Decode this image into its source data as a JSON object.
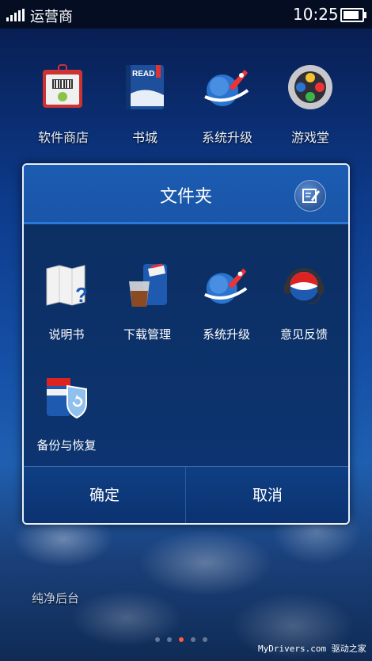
{
  "status_bar": {
    "carrier": "运营商",
    "time": "10:25",
    "battery_level": 0.85
  },
  "desktop_apps": [
    {
      "label": "软件商店",
      "icon": "store-bag-icon"
    },
    {
      "label": "书城",
      "icon": "read-book-icon"
    },
    {
      "label": "系统升级",
      "icon": "rocket-globe-icon"
    },
    {
      "label": "游戏堂",
      "icon": "gamepad-icon"
    }
  ],
  "dialog": {
    "title": "文件夹",
    "edit_icon": "edit-icon",
    "items": [
      {
        "label": "说明书",
        "icon": "manual-map-icon"
      },
      {
        "label": "下载管理",
        "icon": "download-cup-icon"
      },
      {
        "label": "系统升级",
        "icon": "rocket-globe-icon"
      },
      {
        "label": "意见反馈",
        "icon": "headset-feedback-icon"
      },
      {
        "label": "备份与恢复",
        "icon": "backup-restore-icon"
      }
    ],
    "ok_label": "确定",
    "cancel_label": "取消"
  },
  "bottom_label": "纯净后台",
  "pager": {
    "count": 5,
    "active_index": 2
  },
  "watermark": "MyDrivers.com 驱动之家",
  "colors": {
    "accent": "#1b5cb2",
    "dialog_bg": "#0a2e66",
    "active_dot": "#ff5b40"
  }
}
